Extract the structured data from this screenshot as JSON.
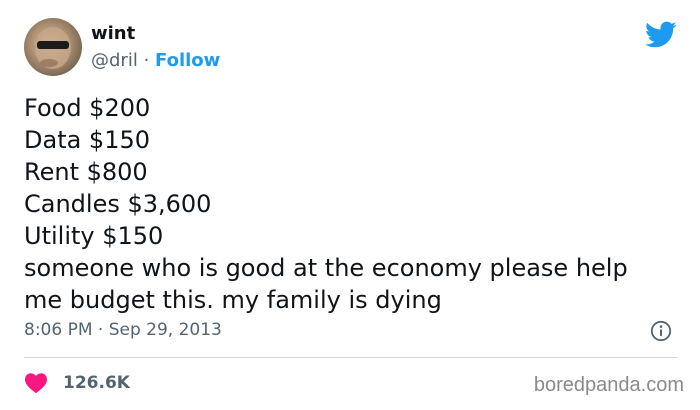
{
  "author": {
    "display_name": "wint",
    "handle": "@dril",
    "separator": "·",
    "follow_label": "Follow",
    "avatar_icon": "avatar-photo"
  },
  "brand": {
    "logo_icon": "twitter-bird-icon",
    "color": "#1d9bf0"
  },
  "tweet": {
    "lines": [
      "Food $200",
      "Data $150",
      "Rent $800",
      "Candles $3,600",
      "Utility $150",
      "someone who is good at the economy please help",
      "me budget this. my family is dying"
    ]
  },
  "meta": {
    "time": "8:06 PM",
    "separator": "·",
    "date": "Sep 29, 2013",
    "info_icon": "info-icon"
  },
  "engagement": {
    "like_icon": "heart-icon",
    "like_color": "#f91880",
    "like_count": "126.6K"
  },
  "watermark": {
    "text": "boredpanda.com"
  }
}
